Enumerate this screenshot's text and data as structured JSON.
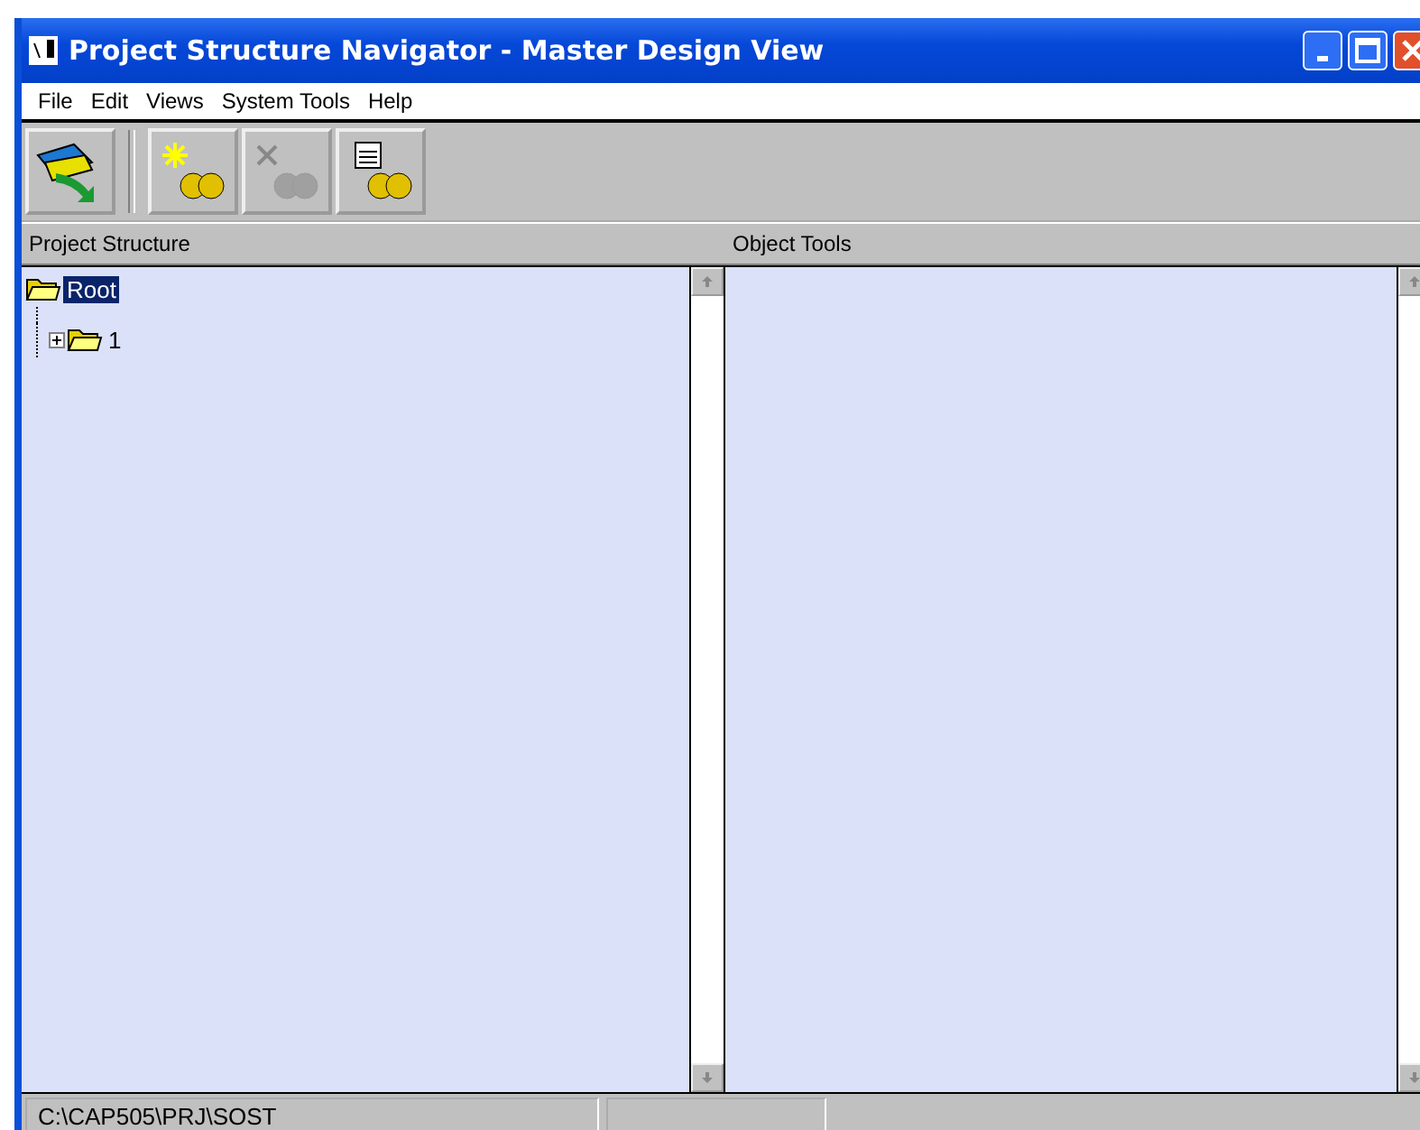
{
  "window": {
    "title": "Project Structure Navigator - Master Design View"
  },
  "menu": [
    {
      "label": "File"
    },
    {
      "label": "Edit"
    },
    {
      "label": "Views"
    },
    {
      "label": "System Tools"
    },
    {
      "label": "Help"
    }
  ],
  "toolbar": [
    [
      {
        "kind": "open",
        "disabled": false
      }
    ],
    [
      {
        "kind": "new",
        "disabled": false
      },
      {
        "kind": "delete",
        "disabled": true
      },
      {
        "kind": "properties",
        "disabled": false
      }
    ]
  ],
  "panels": [
    {
      "title": "Project Structure",
      "tree": [
        {
          "label": "Root",
          "selected": true,
          "expanded": true,
          "children": [
            {
              "label": "1",
              "selected": false,
              "expanded": false
            }
          ]
        }
      ]
    },
    {
      "title": "Object Tools"
    }
  ],
  "status_bar": {
    "path": "C:\\CAP505\\PRJ\\SOST"
  }
}
